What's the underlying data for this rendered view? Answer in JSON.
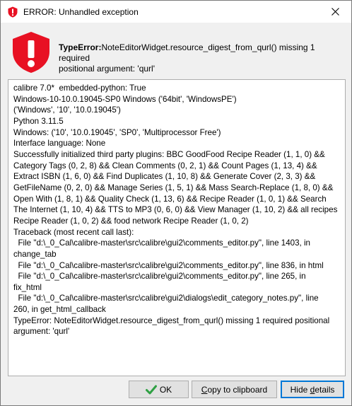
{
  "window": {
    "title": "ERROR: Unhandled exception"
  },
  "error": {
    "type": "TypeError:",
    "message": "NoteEditorWidget.resource_digest_from_qurl() missing 1 required",
    "message_line2": "positional argument: 'qurl'"
  },
  "details": {
    "lines": [
      "calibre 7.0*  embedded-python: True",
      "Windows-10-10.0.19045-SP0 Windows ('64bit', 'WindowsPE')",
      "('Windows', '10', '10.0.19045')",
      "Python 3.11.5",
      "Windows: ('10', '10.0.19045', 'SP0', 'Multiprocessor Free')",
      "Interface language: None",
      "Successfully initialized third party plugins: BBC GoodFood Recipe Reader (1, 1, 0) &&",
      "Category Tags (0, 2, 8) && Clean Comments (0, 2, 1) && Count Pages (1, 13, 4) &&",
      "Extract ISBN (1, 6, 0) && Find Duplicates (1, 10, 8) && Generate Cover (2, 3, 3) &&",
      "GetFileName (0, 2, 0) && Manage Series (1, 5, 1) && Mass Search-Replace (1, 8, 0) &&",
      "Open With (1, 8, 1) && Quality Check (1, 13, 6) && Recipe Reader (1, 0, 1) && Search",
      "The Internet (1, 10, 4) && TTS to MP3 (0, 6, 0) && View Manager (1, 10, 2) && all recipes",
      "Recipe Reader (1, 0, 2) && food network Recipe Reader (1, 0, 2)",
      "Traceback (most recent call last):",
      "  File \"d:\\_0_Cal\\calibre-master\\src\\calibre\\gui2\\comments_editor.py\", line 1403, in",
      "change_tab",
      "  File \"d:\\_0_Cal\\calibre-master\\src\\calibre\\gui2\\comments_editor.py\", line 836, in html",
      "  File \"d:\\_0_Cal\\calibre-master\\src\\calibre\\gui2\\comments_editor.py\", line 265, in",
      "fix_html",
      "  File \"d:\\_0_Cal\\calibre-master\\src\\calibre\\gui2\\dialogs\\edit_category_notes.py\", line",
      "260, in get_html_callback",
      "TypeError: NoteEditorWidget.resource_digest_from_qurl() missing 1 required positional",
      "argument: 'qurl'"
    ]
  },
  "buttons": {
    "ok": "OK",
    "copy_prefix": "C",
    "copy_rest": "opy to clipboard",
    "hide_prefix": "Hide ",
    "hide_underlined": "d",
    "hide_rest": "etails"
  },
  "icons": {
    "title": "error-shield-icon",
    "big": "error-exclamation-shield-icon",
    "close": "close-icon",
    "ok": "checkmark-icon"
  },
  "colors": {
    "error_red": "#e81123",
    "ok_green": "#2ea043",
    "focus_blue": "#0078d7"
  }
}
